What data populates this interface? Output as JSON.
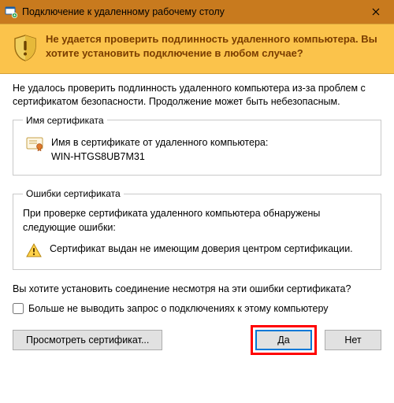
{
  "titlebar": {
    "title": "Подключение к удаленному рабочему столу"
  },
  "banner": {
    "text": "Не удается проверить подлинность удаленного компьютера. Вы хотите установить подключение в любом случае?"
  },
  "intro": "Не удалось проверить подлинность удаленного компьютера из-за проблем с сертификатом безопасности. Продолжение может быть небезопасным.",
  "cert_group": {
    "legend": "Имя сертификата",
    "label": "Имя в сертификате от удаленного компьютера:",
    "value": "WIN-HTGS8UB7M31"
  },
  "errors_group": {
    "legend": "Ошибки сертификата",
    "intro": "При проверке сертификата удаленного компьютера обнаружены следующие ошибки:",
    "item": "Сертификат выдан не имеющим доверия центром сертификации."
  },
  "question": "Вы хотите установить соединение несмотря на эти ошибки сертификата?",
  "checkbox_label": "Больше не выводить запрос о подключениях к этому компьютеру",
  "buttons": {
    "view_cert": "Просмотреть сертификат...",
    "yes": "Да",
    "no": "Нет"
  }
}
